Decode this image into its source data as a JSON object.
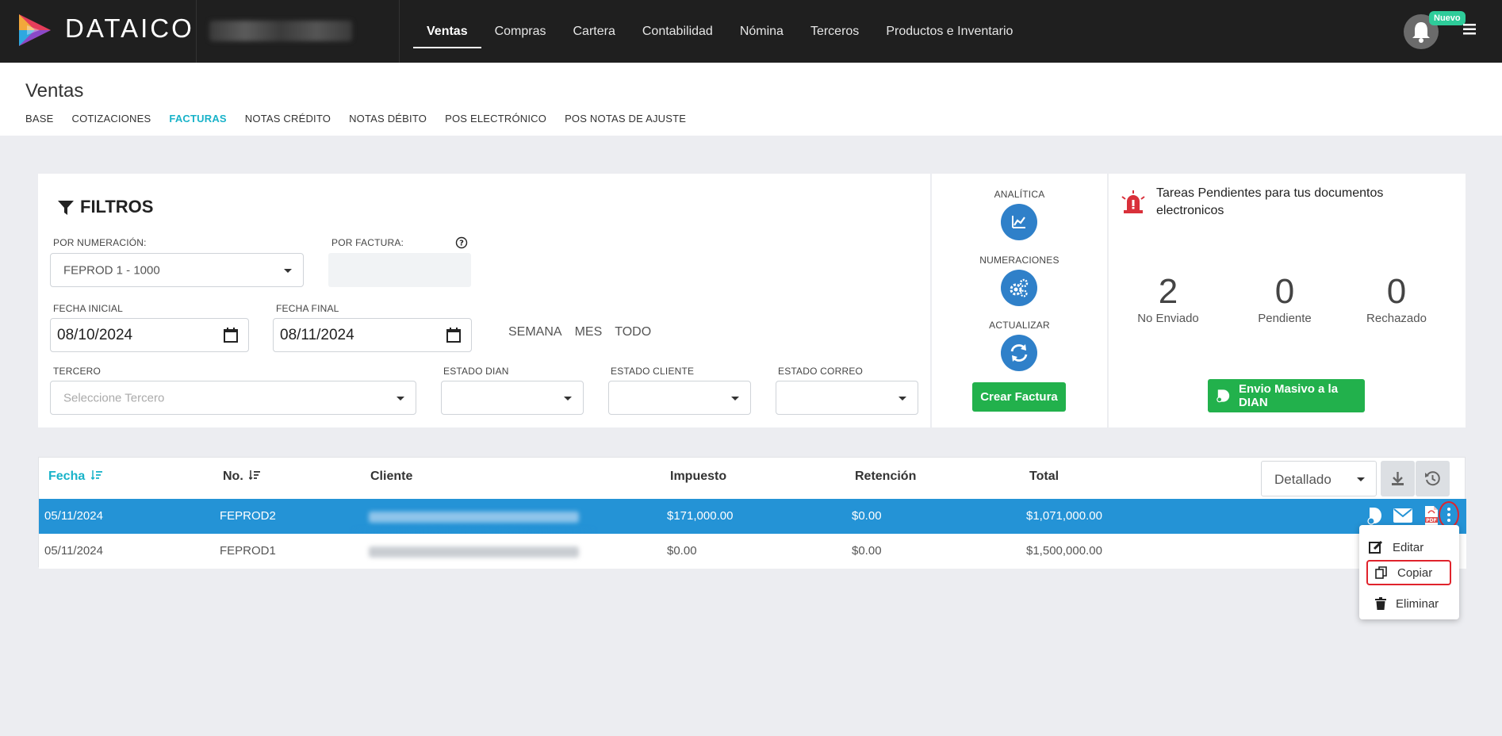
{
  "brand": {
    "name": "DATAICO"
  },
  "nav": {
    "items": [
      "Ventas",
      "Compras",
      "Cartera",
      "Contabilidad",
      "Nómina",
      "Terceros",
      "Productos e Inventario"
    ],
    "active": "Ventas"
  },
  "notifications": {
    "badge": "Nuevo"
  },
  "page": {
    "title": "Ventas"
  },
  "subtabs": [
    "BASE",
    "COTIZACIONES",
    "FACTURAS",
    "NOTAS CRÉDITO",
    "NOTAS DÉBITO",
    "POS ELECTRÓNICO",
    "POS NOTAS DE AJUSTE"
  ],
  "filters": {
    "title": "FILTROS",
    "numeracion_label": "POR NUMERACIÓN:",
    "numeracion_value": "FEPROD 1 - 1000",
    "factura_label": "POR FACTURA:",
    "fecha_inicial_label": "FECHA INICIAL",
    "fecha_inicial_value": "08/10/2024",
    "fecha_final_label": "FECHA FINAL",
    "fecha_final_value": "08/11/2024",
    "quick": [
      "SEMANA",
      "MES",
      "TODO"
    ],
    "tercero_label": "TERCERO",
    "tercero_placeholder": "Seleccione Tercero",
    "estado_dian_label": "ESTADO DIAN",
    "estado_cliente_label": "ESTADO CLIENTE",
    "estado_correo_label": "ESTADO CORREO"
  },
  "actions": {
    "analitica": "ANALÍTICA",
    "numeraciones": "NUMERACIONES",
    "actualizar": "ACTUALIZAR",
    "crear_factura": "Crear Factura"
  },
  "tasks": {
    "title": "Tareas Pendientes para tus documentos electronicos",
    "stats": [
      {
        "value": "2",
        "label": "No Enviado"
      },
      {
        "value": "0",
        "label": "Pendiente"
      },
      {
        "value": "0",
        "label": "Rechazado"
      }
    ],
    "envio_masivo": "Envio Masivo a la DIAN"
  },
  "table": {
    "headers": {
      "fecha": "Fecha",
      "no": "No.",
      "cliente": "Cliente",
      "impuesto": "Impuesto",
      "retencion": "Retención",
      "total": "Total"
    },
    "view_select": "Detallado",
    "rows": [
      {
        "fecha": "05/11/2024",
        "no": "FEPROD2",
        "impuesto": "$171,000.00",
        "retencion": "$0.00",
        "total": "$1,071,000.00"
      },
      {
        "fecha": "05/11/2024",
        "no": "FEPROD1",
        "impuesto": "$0.00",
        "retencion": "$0.00",
        "total": "$1,500,000.00"
      }
    ]
  },
  "row_menu": {
    "editar": "Editar",
    "copiar": "Copiar",
    "eliminar": "Eliminar"
  },
  "colors": {
    "accent": "#19b3c9",
    "primary": "#2f80c9",
    "selected_row": "#2493d6",
    "success": "#22b14c",
    "alert": "#d9303a"
  }
}
